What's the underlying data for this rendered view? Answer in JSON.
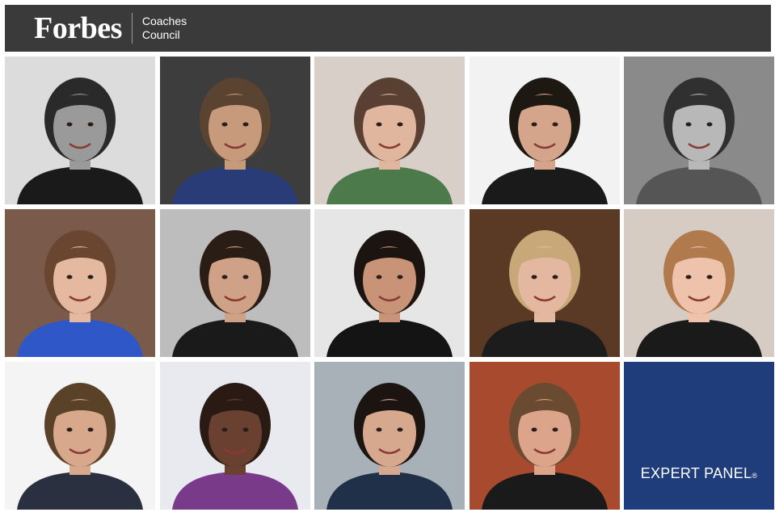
{
  "header": {
    "logo": "Forbes",
    "council_line1": "Coaches",
    "council_line2": "Council"
  },
  "panel": {
    "label": "EXPERT PANEL",
    "mark": "®"
  },
  "portraits": [
    {
      "bg": "#dcdcdc",
      "skin": "#9a9a9a",
      "hair": "#2a2a2a",
      "shirt": "#1a1a1a"
    },
    {
      "bg": "#3d3d3d",
      "skin": "#c79a7c",
      "hair": "#5a4330",
      "shirt": "#2a3c78"
    },
    {
      "bg": "#d8cfc8",
      "skin": "#e0b79e",
      "hair": "#5a4032",
      "shirt": "#4d7a4a"
    },
    {
      "bg": "#f2f2f2",
      "skin": "#d4a58a",
      "hair": "#1e1812",
      "shirt": "#1a1a1a"
    },
    {
      "bg": "#8a8a8a",
      "skin": "#b8b8b8",
      "hair": "#303030",
      "shirt": "#555555"
    },
    {
      "bg": "#7a5a4a",
      "skin": "#e4b9a0",
      "hair": "#6a4630",
      "shirt": "#2f57c7"
    },
    {
      "bg": "#bdbdbd",
      "skin": "#cfa186",
      "hair": "#2a1d16",
      "shirt": "#1a1a1a"
    },
    {
      "bg": "#e6e6e6",
      "skin": "#c99378",
      "hair": "#1c1410",
      "shirt": "#141414"
    },
    {
      "bg": "#5a3a24",
      "skin": "#e4b8a0",
      "hair": "#c8a878",
      "shirt": "#1c1c1c"
    },
    {
      "bg": "#d6ccc4",
      "skin": "#efc3ab",
      "hair": "#b07a4c",
      "shirt": "#1a1a1a"
    },
    {
      "bg": "#f4f4f4",
      "skin": "#d8a88c",
      "hair": "#5a4228",
      "shirt": "#2a3040"
    },
    {
      "bg": "#e8eaf0",
      "skin": "#6a4030",
      "hair": "#2a1a14",
      "shirt": "#7a3a8a"
    },
    {
      "bg": "#a8b0b8",
      "skin": "#d6a88e",
      "hair": "#1c1410",
      "shirt": "#203048"
    },
    {
      "bg": "#a84a2e",
      "skin": "#dca48a",
      "hair": "#6a4a30",
      "shirt": "#1a1a1a"
    }
  ]
}
